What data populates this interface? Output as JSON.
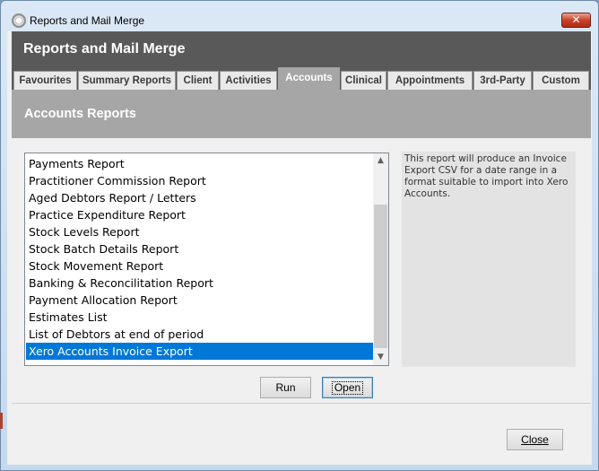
{
  "window": {
    "title": "Reports and Mail Merge",
    "close_symbol": "✕"
  },
  "header": {
    "title": "Reports and Mail Merge"
  },
  "tabs": [
    {
      "label": "Favourites",
      "active": false
    },
    {
      "label": "Summary Reports",
      "active": false
    },
    {
      "label": "Client",
      "active": false
    },
    {
      "label": "Activities",
      "active": false
    },
    {
      "label": "Accounts",
      "active": true
    },
    {
      "label": "Clinical",
      "active": false
    },
    {
      "label": "Appointments",
      "active": false
    },
    {
      "label": "3rd-Party",
      "active": false
    },
    {
      "label": "Custom",
      "active": false
    }
  ],
  "section": {
    "title": "Accounts Reports"
  },
  "reports": {
    "items": [
      "Payments Report",
      "Practitioner Commission Report",
      "Aged Debtors Report / Letters",
      "Practice Expenditure Report",
      "Stock Levels Report",
      "Stock Batch Details Report",
      "Stock Movement Report",
      "Banking & Reconcilitation Report",
      "Payment Allocation Report",
      "Estimates List",
      "List of Debtors at end of period",
      "Xero Accounts Invoice Export"
    ],
    "selected_index": 11
  },
  "description": "This report will produce an Invoice Export CSV for a date range in a format suitable to import into Xero Accounts.",
  "buttons": {
    "run": "Run",
    "open": "Open",
    "close": "Close"
  },
  "icons": {
    "scroll_up": "▲",
    "scroll_down": "▼"
  },
  "colors": {
    "header_bg": "#595959",
    "section_bg": "#a6a6a6",
    "selection": "#0078d7"
  }
}
